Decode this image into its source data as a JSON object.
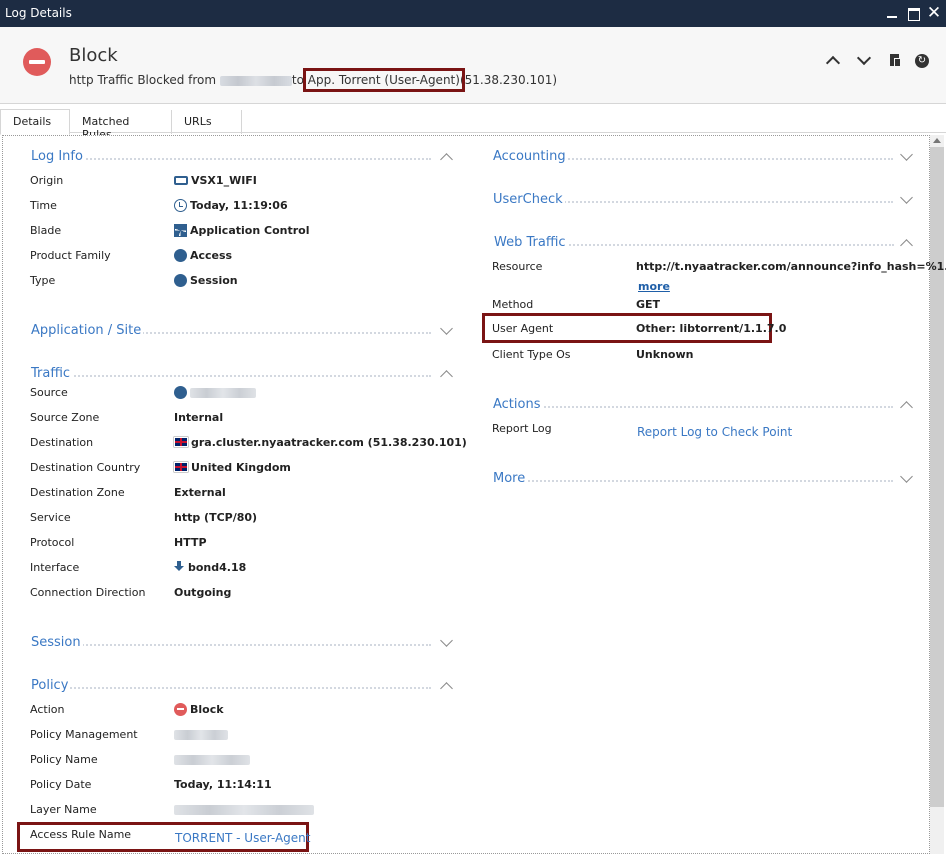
{
  "window": {
    "title": "Log Details"
  },
  "header": {
    "title": "Block",
    "desc_prefix": "http Traffic Blocked from",
    "desc_to": "to",
    "desc_app": "App. Torrent (User-Agent)",
    "desc_ip": "(51.38.230.101)"
  },
  "tabs": [
    "Details",
    "Matched Rules",
    "URLs"
  ],
  "left": {
    "log_info": {
      "title": "Log Info",
      "rows": [
        {
          "label": "Origin",
          "value": "VSX1_WIFI",
          "icon": "device-icon"
        },
        {
          "label": "Time",
          "value": "Today, 11:19:06",
          "icon": "clock-icon"
        },
        {
          "label": "Blade",
          "value": "Application Control",
          "icon": "grid-icon"
        },
        {
          "label": "Product Family",
          "value": "Access",
          "icon": "access-icon"
        },
        {
          "label": "Type",
          "value": "Session",
          "icon": "session-icon"
        }
      ]
    },
    "app_site": {
      "title": "Application / Site"
    },
    "traffic": {
      "title": "Traffic",
      "rows": [
        {
          "label": "Source",
          "value": "",
          "icon": "globe-icon"
        },
        {
          "label": "Source Zone",
          "value": "Internal"
        },
        {
          "label": "Destination",
          "value": "gra.cluster.nyaatracker.com (51.38.230.101)",
          "icon": "uk-flag-icon"
        },
        {
          "label": "Destination Country",
          "value": "United Kingdom",
          "icon": "uk-flag-icon"
        },
        {
          "label": "Destination Zone",
          "value": "External"
        },
        {
          "label": "Service",
          "value": "http (TCP/80)"
        },
        {
          "label": "Protocol",
          "value": "HTTP"
        },
        {
          "label": "Interface",
          "value": "bond4.18",
          "icon": "download-arrow-icon"
        },
        {
          "label": "Connection Direction",
          "value": "Outgoing"
        }
      ]
    },
    "session": {
      "title": "Session"
    },
    "policy": {
      "title": "Policy",
      "rows": [
        {
          "label": "Action",
          "value": "Block",
          "icon": "block-icon"
        },
        {
          "label": "Policy Management",
          "value": ""
        },
        {
          "label": "Policy Name",
          "value": ""
        },
        {
          "label": "Policy Date",
          "value": "Today, 11:14:11"
        },
        {
          "label": "Layer Name",
          "value": ""
        },
        {
          "label": "Access Rule Name",
          "value": "TORRENT - User-Agent"
        }
      ]
    }
  },
  "right": {
    "accounting": {
      "title": "Accounting"
    },
    "usercheck": {
      "title": "UserCheck"
    },
    "web_traffic": {
      "title": "Web Traffic",
      "rows": [
        {
          "label": "Resource",
          "value": "http://t.nyaatracker.com/announce?info_hash=%1..."
        },
        {
          "label": "Method",
          "value": "GET"
        },
        {
          "label": "User Agent",
          "value": "Other: libtorrent/1.1.7.0"
        },
        {
          "label": "Client Type Os",
          "value": "Unknown"
        }
      ],
      "more": "more"
    },
    "actions": {
      "title": "Actions",
      "rows": [
        {
          "label": "Report Log",
          "value": "Report Log to Check Point"
        }
      ]
    },
    "more": {
      "title": "More"
    }
  }
}
